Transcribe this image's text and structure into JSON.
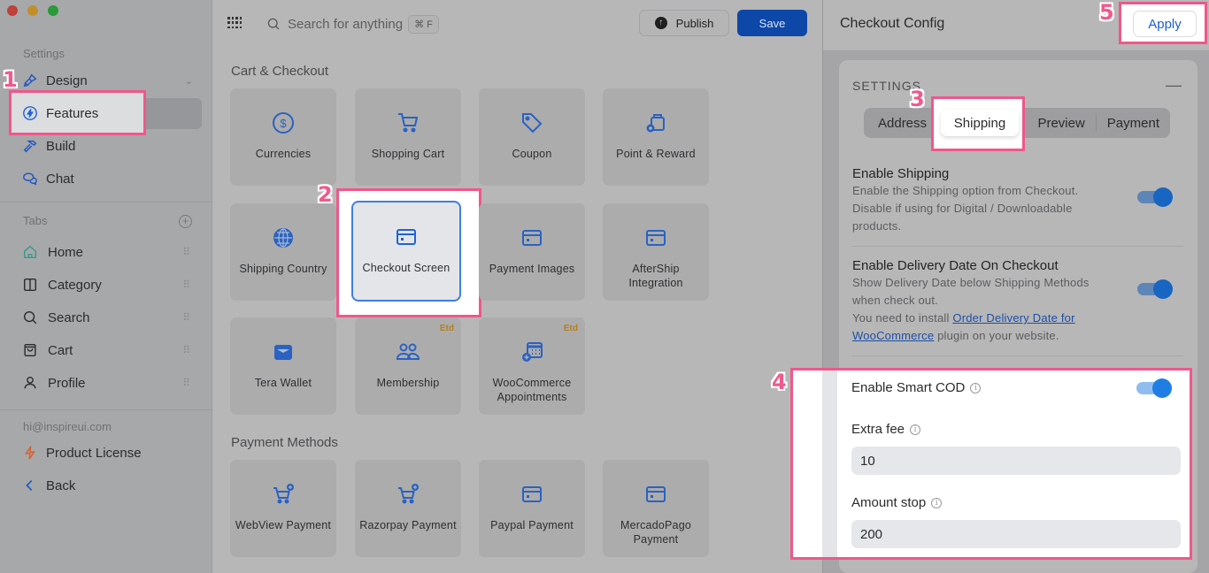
{
  "sidebar": {
    "settings_label": "Settings",
    "settings_items": [
      {
        "label": "Design",
        "icon": "paintbrush-icon"
      },
      {
        "label": "Features",
        "icon": "lightning-circle-icon"
      },
      {
        "label": "Build",
        "icon": "hammer-icon"
      },
      {
        "label": "Chat",
        "icon": "chat-bubbles-icon"
      }
    ],
    "tabs_label": "Tabs",
    "tabs": [
      {
        "label": "Home",
        "icon": "home-icon"
      },
      {
        "label": "Category",
        "icon": "columns-icon"
      },
      {
        "label": "Search",
        "icon": "search-icon"
      },
      {
        "label": "Cart",
        "icon": "bag-icon"
      },
      {
        "label": "Profile",
        "icon": "user-icon"
      }
    ],
    "email": "hi@inspireui.com",
    "product_license": "Product License",
    "back": "Back"
  },
  "toolbar": {
    "search_placeholder": "Search for anything",
    "shortcut": "⌘ F",
    "publish_label": "Publish",
    "save_label": "Save"
  },
  "main": {
    "sections": [
      {
        "title": "Cart & Checkout",
        "cards": [
          {
            "label": "Currencies",
            "icon": "dollar-circle-icon"
          },
          {
            "label": "Shopping Cart",
            "icon": "shopping-cart-icon"
          },
          {
            "label": "Coupon",
            "icon": "tag-icon"
          },
          {
            "label": "Point & Reward",
            "icon": "bag-plus-icon"
          },
          {
            "label": "Shipping Country",
            "icon": "globe-icon"
          },
          {
            "label": "Checkout Screen",
            "icon": "credit-card-icon",
            "selected": true
          },
          {
            "label": "Payment Images",
            "icon": "credit-card-icon"
          },
          {
            "label": "AfterShip Integration",
            "icon": "credit-card-icon"
          },
          {
            "label": "Tera Wallet",
            "icon": "wallet-icon"
          },
          {
            "label": "Membership",
            "icon": "users-icon",
            "badge": "Etd"
          },
          {
            "label": "WooCommerce Appointments",
            "icon": "calendar-plus-icon",
            "badge": "Etd"
          }
        ]
      },
      {
        "title": "Payment Methods",
        "cards": [
          {
            "label": "WebView Payment",
            "icon": "cart-plus-icon"
          },
          {
            "label": "Razorpay Payment",
            "icon": "cart-plus-icon"
          },
          {
            "label": "Paypal Payment",
            "icon": "credit-card-icon"
          },
          {
            "label": "MercadoPago Payment",
            "icon": "credit-card-icon"
          }
        ]
      }
    ]
  },
  "panel": {
    "title": "Checkout Config",
    "apply_label": "Apply",
    "settings_label": "SETTINGS",
    "segments": [
      "Address",
      "Shipping",
      "Preview",
      "Payment"
    ],
    "active_segment": "Shipping",
    "enable_shipping": {
      "title": "Enable Shipping",
      "desc": "Enable the Shipping option from Checkout. Disable if using for Digital / Downloadable products.",
      "on": true
    },
    "delivery_date": {
      "title": "Enable Delivery Date On Checkout",
      "desc": "Show Delivery Date below Shipping Methods when check out.",
      "install_prefix": "You need to install ",
      "link_text": "Order Delivery Date for WooCommerce",
      "install_suffix": " plugin on your website.",
      "on": true
    },
    "smart_cod": {
      "title": "Enable Smart COD",
      "on": true,
      "extra_fee_label": "Extra fee",
      "extra_fee_value": "10",
      "amount_stop_label": "Amount stop",
      "amount_stop_value": "200"
    }
  },
  "annotations": [
    "1",
    "2",
    "3",
    "4",
    "5"
  ]
}
